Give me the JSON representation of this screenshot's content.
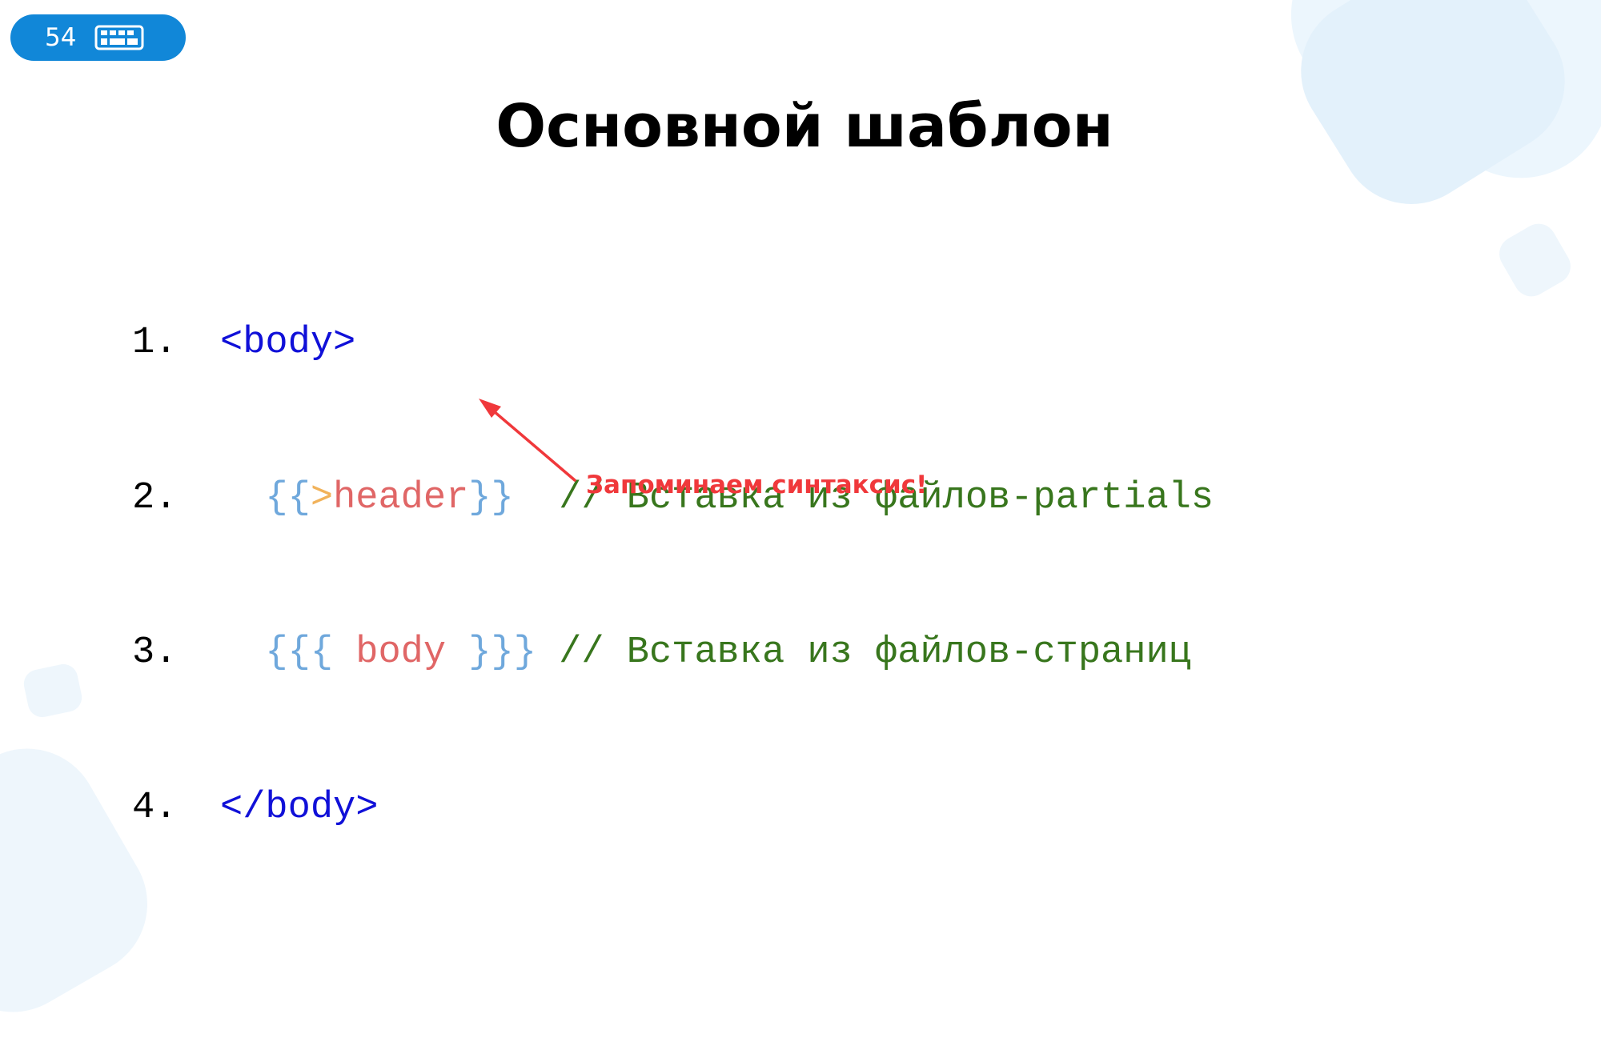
{
  "slide": {
    "number": "54",
    "title": "Основной шаблон",
    "icon": "keyboard-icon"
  },
  "code": {
    "lines": [
      {
        "num": "1.",
        "open_tag": "<body>"
      },
      {
        "num": "2.",
        "indent": "  ",
        "brace_open": "{{",
        "gt": ">",
        "name": "header",
        "brace_close": "}}",
        "gap": "  ",
        "comment": "// Вставка из файлов-partials"
      },
      {
        "num": "3.",
        "indent": "  ",
        "brace_open": "{{{",
        "name": " body ",
        "brace_close": "}}}",
        "gap": " ",
        "comment": "// Вставка из файлов-страниц"
      },
      {
        "num": "4.",
        "close_tag": "</body>"
      }
    ]
  },
  "annotation": {
    "text": "Запоминаем синтаксис!",
    "color": "#f0383b"
  },
  "colors": {
    "badge": "#1187d8",
    "tag": "#1010d8",
    "brace": "#6fa8dc",
    "partial_marker": "#f1b25a",
    "variable": "#e06666",
    "comment": "#38761d"
  }
}
